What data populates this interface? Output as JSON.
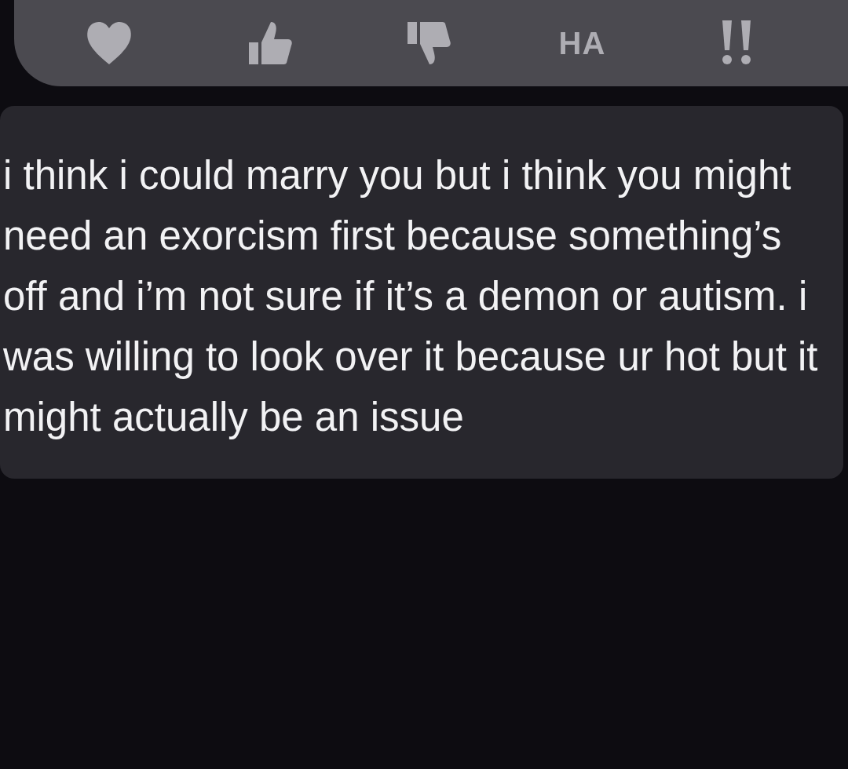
{
  "reactions": [
    {
      "kind": "heart"
    },
    {
      "kind": "thumbs_up"
    },
    {
      "kind": "thumbs_down"
    },
    {
      "kind": "haha",
      "label": "HA"
    },
    {
      "kind": "emphasis"
    }
  ],
  "message": {
    "text": "i think i could marry you but i think you might need an exorcism first because something’s off and i’m not sure if it’s a demon or autism. i was willing to look over it because ur hot but it might actually be an issue"
  }
}
